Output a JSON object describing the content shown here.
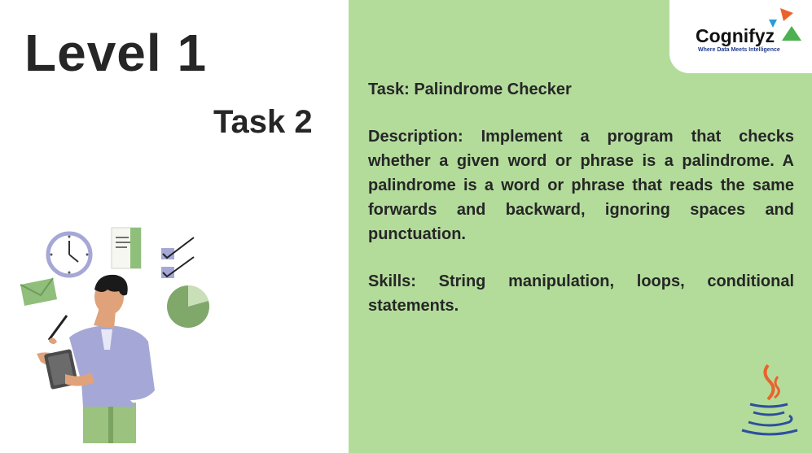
{
  "slide": {
    "level_title": "Level 1",
    "task_number": "Task 2"
  },
  "logo": {
    "name": "Cognifyz",
    "tagline": "Where Data Meets Intelligence",
    "colors": [
      "#e8642c",
      "#2b9cd8",
      "#4caf50"
    ]
  },
  "task_card": {
    "task_line": "Task: Palindrome Checker",
    "description": "Description: Implement a program that checks whether a given word or phrase is a palindrome. A palindrome is a word or phrase that reads the same forwards and backward, ignoring spaces and punctuation.",
    "skills": "Skills: String manipulation, loops, conditional statements."
  },
  "icons": [
    "person-with-clipboard-illustration",
    "clock-icon",
    "document-icon",
    "checklist-icon",
    "pie-chart-icon",
    "envelope-icon",
    "java-logo-icon"
  ],
  "colors": {
    "panel": "#b3dc9b",
    "text": "#262626"
  }
}
